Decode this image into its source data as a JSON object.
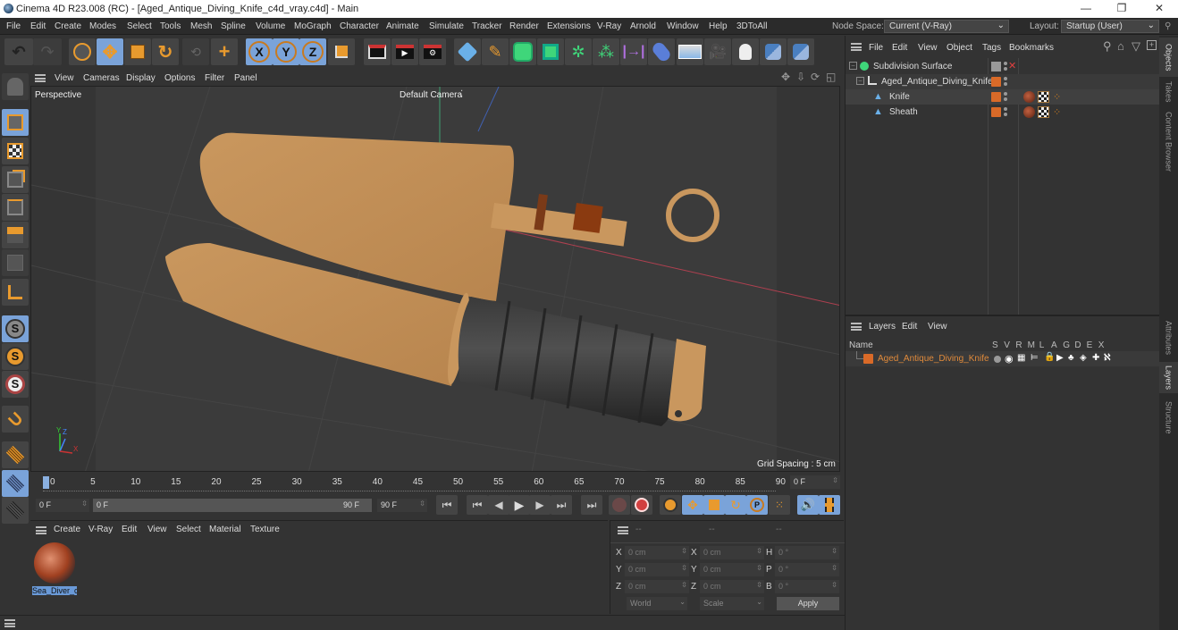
{
  "window": {
    "title": "Cinema 4D R23.008 (RC) - [Aged_Antique_Diving_Knife_c4d_vray.c4d] - Main",
    "controls": {
      "minimize": "—",
      "restore": "❐",
      "close": "✕"
    }
  },
  "menubar": {
    "items": [
      "File",
      "Edit",
      "Create",
      "Modes",
      "Select",
      "Tools",
      "Mesh",
      "Spline",
      "Volume",
      "MoGraph",
      "Character",
      "Animate",
      "Simulate",
      "Tracker",
      "Render",
      "Extensions",
      "V-Ray",
      "Arnold",
      "Window",
      "Help",
      "3DToAll"
    ],
    "node_space_label": "Node Space:",
    "node_space_value": "Current (V-Ray)",
    "layout_label": "Layout:",
    "layout_value": "Startup (User)"
  },
  "toolbar": {
    "icons": [
      "undo-icon",
      "redo-icon",
      "select-tool-icon",
      "move-tool-icon",
      "scale-tool-icon",
      "rotate-tool-icon",
      "recent-tools-icon",
      "add-tool-icon",
      "x-axis-icon",
      "y-axis-icon",
      "z-axis-icon",
      "coordinate-system-icon",
      "render-view-icon",
      "render-picture-viewer-icon",
      "render-settings-icon",
      "cube-icon",
      "pen-icon",
      "subdivision-icon",
      "extrude-icon",
      "cloner-icon",
      "mograph-icon",
      "deformer-icon",
      "field-icon",
      "floor-icon",
      "camera-icon",
      "light-icon",
      "python-icon",
      "python-2-icon"
    ]
  },
  "viewport": {
    "menu": [
      "View",
      "Cameras",
      "Display",
      "Options",
      "Filter",
      "Panel"
    ],
    "view_name": "Perspective",
    "camera_label": "Default Camera",
    "grid_spacing": "Grid Spacing : 5 cm",
    "axis_labels": {
      "x": "X",
      "y": "Y",
      "z": "Z"
    }
  },
  "left_tools": [
    "make-editable-icon",
    "model-mode-icon",
    "texture-mode-icon",
    "points-mode-icon",
    "edges-mode-icon",
    "polygons-mode-icon",
    "uv-mode-icon",
    "axis-mode-icon",
    "snap-icon",
    "snap-settings-icon",
    "workplane-snap-icon",
    "magnet-icon",
    "workplane-icon",
    "locked-workplane-icon",
    "workplane-rotate-icon"
  ],
  "timeline": {
    "ticks": [
      "0",
      "5",
      "10",
      "15",
      "20",
      "25",
      "30",
      "35",
      "40",
      "45",
      "50",
      "55",
      "60",
      "65",
      "70",
      "75",
      "80",
      "85",
      "90"
    ],
    "current_frame": "0 F",
    "start_frame": "0 F",
    "range_start": "0 F",
    "range_end": "90 F",
    "end_frame": "90 F",
    "current_frame_right": "0 F"
  },
  "material_panel": {
    "menu": [
      "Create",
      "V-Ray",
      "Edit",
      "View",
      "Select",
      "Material",
      "Texture"
    ],
    "materials": [
      {
        "name": "Sea_Diver_c"
      }
    ]
  },
  "coord_panel": {
    "headers": [
      "--",
      "--",
      "--"
    ],
    "rows": [
      {
        "l1": "X",
        "v1": "0 cm",
        "l2": "X",
        "v2": "0 cm",
        "l3": "H",
        "v3": "0 °"
      },
      {
        "l1": "Y",
        "v1": "0 cm",
        "l2": "Y",
        "v2": "0 cm",
        "l3": "P",
        "v3": "0 °"
      },
      {
        "l1": "Z",
        "v1": "0 cm",
        "l2": "Z",
        "v2": "0 cm",
        "l3": "B",
        "v3": "0 °"
      }
    ],
    "space_select": "World",
    "mode_select": "Scale",
    "apply_label": "Apply"
  },
  "object_panel": {
    "menu": [
      "File",
      "Edit",
      "View",
      "Object",
      "Tags",
      "Bookmarks"
    ],
    "objects": [
      {
        "name": "Subdivision Surface"
      },
      {
        "name": "Aged_Antique_Diving_Knife"
      },
      {
        "name": "Knife"
      },
      {
        "name": "Sheath"
      }
    ]
  },
  "layer_panel": {
    "menu": [
      "Layers",
      "Edit",
      "View"
    ],
    "column_name": "Name",
    "columns": [
      "S",
      "V",
      "R",
      "M",
      "L",
      "A",
      "G",
      "D",
      "E",
      "X"
    ],
    "layers": [
      {
        "name": "Aged_Antique_Diving_Knife",
        "color": "#d96a28"
      }
    ]
  },
  "side_tabs": [
    "Objects",
    "Takes",
    "Content Browser",
    "Attributes",
    "Layers",
    "Structure"
  ],
  "colors": {
    "accent": "#7aa3d9",
    "orange": "#d96a28",
    "layer_text": "#e08a3a"
  }
}
